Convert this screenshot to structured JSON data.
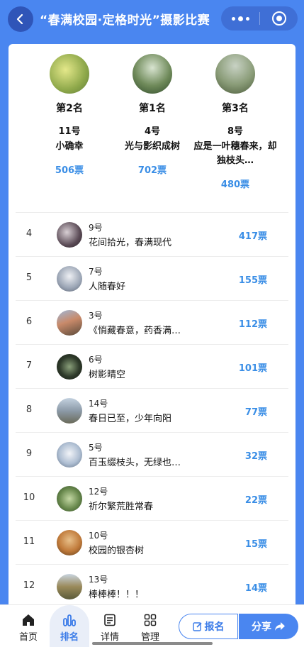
{
  "header": {
    "title": "“春满校园·定格时光”摄影比赛",
    "back_icon": "chevron-left-icon",
    "more_icon": "more-dots-icon",
    "close_icon": "target-close-icon"
  },
  "podium": [
    {
      "rank_label": "第2名",
      "number": "11号",
      "name": "小确幸",
      "votes": "506票",
      "photo_color": "#b9c76a"
    },
    {
      "rank_label": "第1名",
      "number": "4号",
      "name": "光与影织成树",
      "votes": "702票",
      "photo_color": "#6f8a5a"
    },
    {
      "rank_label": "第3名",
      "number": "8号",
      "name": "应是一叶穗春来，却独枝头…",
      "votes": "480票",
      "photo_color": "#8a9c78"
    }
  ],
  "ranking": [
    {
      "rank": "4",
      "number": "9号",
      "name": "花间拾光，春满现代",
      "votes": "417票",
      "photo_color": "#5a4a55"
    },
    {
      "rank": "5",
      "number": "7号",
      "name": "人随春好",
      "votes": "155票",
      "photo_color": "#9aa4b4"
    },
    {
      "rank": "6",
      "number": "3号",
      "name": "《悄藏春意，药香满…",
      "votes": "112票",
      "photo_color": "#7a6a5a"
    },
    {
      "rank": "7",
      "number": "6号",
      "name": "树影晴空",
      "votes": "101票",
      "photo_color": "#2e3a2a"
    },
    {
      "rank": "8",
      "number": "14号",
      "name": "春日已至，少年向阳",
      "votes": "77票",
      "photo_color": "#8c9aa8"
    },
    {
      "rank": "9",
      "number": "5号",
      "name": "百玉缀枝头，无绿也…",
      "votes": "32票",
      "photo_color": "#aebed2"
    },
    {
      "rank": "10",
      "number": "12号",
      "name": "祈尔繁荒胜常春",
      "votes": "22票",
      "photo_color": "#6a8a4e"
    },
    {
      "rank": "11",
      "number": "10号",
      "name": "校园的银杏树",
      "votes": "15票",
      "photo_color": "#c07a3a"
    },
    {
      "rank": "12",
      "number": "13号",
      "name": "棒棒棒！！！",
      "votes": "14票",
      "photo_color": "#7e7a5a"
    }
  ],
  "tabbar": {
    "tabs": [
      {
        "label": "首页",
        "icon": "home-icon"
      },
      {
        "label": "排名",
        "icon": "bar-chart-icon"
      },
      {
        "label": "详情",
        "icon": "document-icon"
      },
      {
        "label": "管理",
        "icon": "grid-icon"
      }
    ],
    "signup_label": "报名",
    "share_label": "分享",
    "accent_color": "#4a86f0"
  }
}
